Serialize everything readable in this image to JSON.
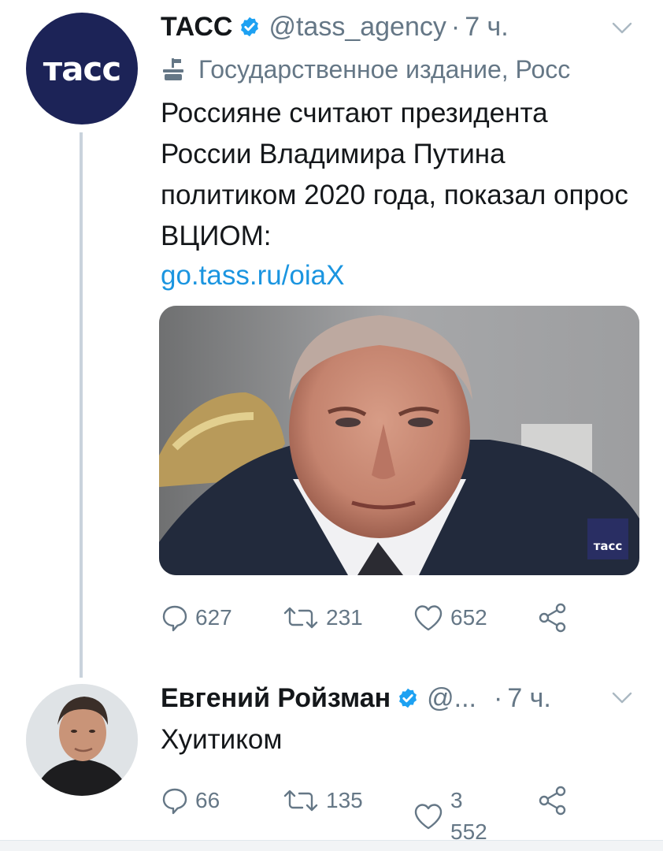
{
  "tweet": {
    "avatar_text": "тасс",
    "author": "ТАСС",
    "handle": "@tass_agency",
    "separator": "·",
    "time": "7 ч.",
    "affiliation": "Государственное издание, Росс",
    "text": "Россияне считают президента России Владимира Путина политиком 2020 года, показал опрос ВЦИОМ:",
    "link": "go.tass.ru/oiaX",
    "media_watermark": "тасс",
    "actions": {
      "replies": "627",
      "retweets": "231",
      "likes": "652"
    }
  },
  "reply": {
    "author": "Евгений Ройзман",
    "handle": "@...",
    "separator": "·",
    "time": "7 ч.",
    "text": "Хуитиком",
    "actions": {
      "replies": "66",
      "retweets": "135",
      "likes": "3 552"
    }
  },
  "colors": {
    "text": "#14171a",
    "secondary": "#657786",
    "link": "#1b95e0",
    "verified": "#1da1f2",
    "tass_brand": "#1c2357",
    "thread_line": "#c9d3dc"
  },
  "icons": {
    "verified": "verified-badge-icon",
    "affiliation": "government-affiliation-icon",
    "menu": "chevron-down-icon",
    "reply": "reply-icon",
    "retweet": "retweet-icon",
    "like": "heart-icon",
    "share": "share-icon"
  }
}
